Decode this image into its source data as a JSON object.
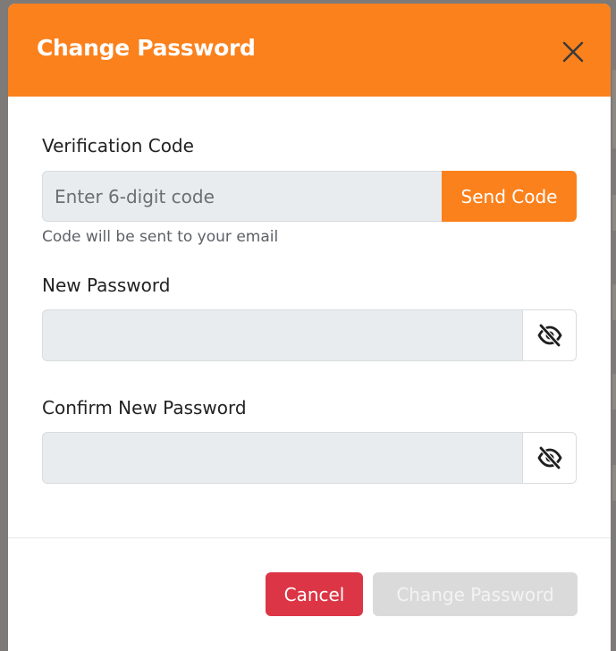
{
  "dialog": {
    "title": "Change Password",
    "close_icon": "close-icon",
    "header_color": "#fb811c"
  },
  "verification": {
    "label": "Verification Code",
    "placeholder": "Enter 6-digit code",
    "value": "",
    "send_button": "Send Code",
    "help_text": "Code will be sent to your email"
  },
  "new_password": {
    "label": "New Password",
    "value": "",
    "toggle_icon": "eye-slash-icon"
  },
  "confirm_password": {
    "label": "Confirm New Password",
    "value": "",
    "toggle_icon": "eye-slash-icon"
  },
  "footer": {
    "cancel_label": "Cancel",
    "submit_label": "Change Password",
    "submit_disabled": true,
    "cancel_color": "#dc3545"
  }
}
